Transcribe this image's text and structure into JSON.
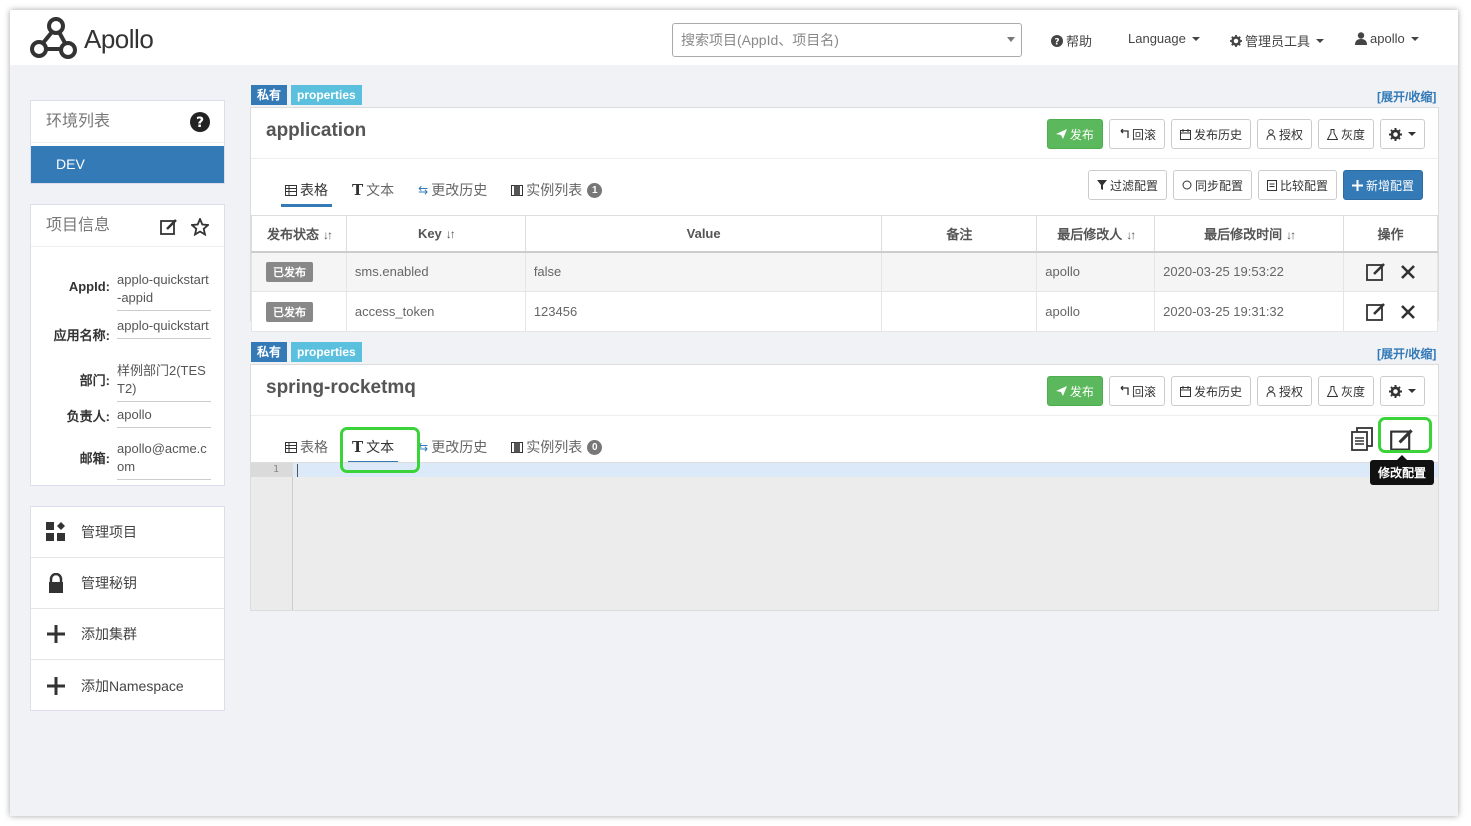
{
  "header": {
    "brand": "Apollo",
    "search_placeholder": "搜索项目(AppId、项目名)",
    "help": "帮助",
    "language": "Language",
    "admin_tools": "管理员工具",
    "user": "apollo"
  },
  "sidebar": {
    "env_title": "环境列表",
    "env_items": [
      "DEV"
    ],
    "info_title": "项目信息",
    "info": [
      {
        "key": "AppId:",
        "value": "applo-quickstart-appid"
      },
      {
        "key": "应用名称:",
        "value": "applo-quickstart"
      },
      {
        "key": "部门:",
        "value": "样例部门2(TEST2)"
      },
      {
        "key": "负责人:",
        "value": "apollo"
      },
      {
        "key": "邮箱:",
        "value": "apollo@acme.com"
      }
    ],
    "menu": [
      "管理项目",
      "管理秘钥",
      "添加集群",
      "添加Namespace"
    ]
  },
  "namespace_common": {
    "tag_private": "私有",
    "tag_format": "properties",
    "expand_collapse": "[展开/收缩]",
    "btn_publish": "发布",
    "btn_rollback": "回滚",
    "btn_history": "发布历史",
    "btn_grant": "授权",
    "btn_gray": "灰度",
    "tab_table": "表格",
    "tab_text": "文本",
    "tab_change_history": "更改历史",
    "tab_instances": "实例列表"
  },
  "ns1": {
    "name": "application",
    "instance_count": "1",
    "btn_filter": "过滤配置",
    "btn_sync": "同步配置",
    "btn_compare": "比较配置",
    "btn_add": "新增配置",
    "columns": [
      "发布状态",
      "Key",
      "Value",
      "备注",
      "最后修改人",
      "最后修改时间",
      "操作"
    ],
    "rows": [
      {
        "status": "已发布",
        "key": "sms.enabled",
        "value": "false",
        "comment": "",
        "modifier": "apollo",
        "time": "2020-03-25 19:53:22"
      },
      {
        "status": "已发布",
        "key": "access_token",
        "value": "123456",
        "comment": "",
        "modifier": "apollo",
        "time": "2020-03-25 19:31:32"
      }
    ]
  },
  "ns2": {
    "name": "spring-rocketmq",
    "instance_count": "0",
    "line_number": "1",
    "tooltip": "修改配置"
  },
  "colors": {
    "primary": "#337ab7",
    "success": "#5cb85c",
    "info": "#5bc0de",
    "highlight": "#3ad43a"
  }
}
